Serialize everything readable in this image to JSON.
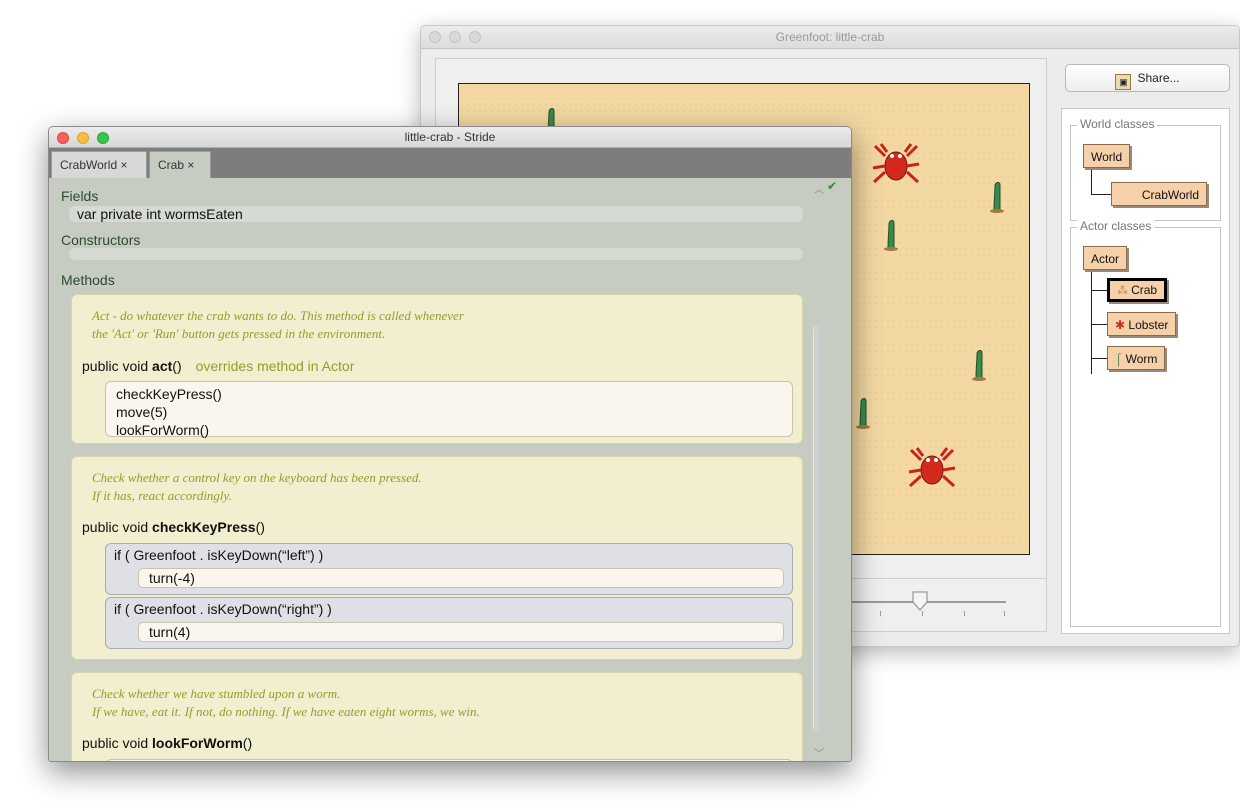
{
  "greenfoot": {
    "title": "Greenfoot: little-crab",
    "share_label": "Share...",
    "world_group_label": "World classes",
    "actor_group_label": "Actor classes",
    "classes": {
      "world": "World",
      "crabworld": "CrabWorld",
      "actor": "Actor",
      "crab": "Crab",
      "lobster": "Lobster",
      "worm": "Worm"
    },
    "colors": {
      "sand": "#f4d8a3",
      "class_box": "#f6d0a8"
    }
  },
  "stride": {
    "title": "little-crab - Stride",
    "tabs": [
      {
        "label": "CrabWorld ×"
      },
      {
        "label": "Crab ×"
      }
    ],
    "fields_label": "Fields",
    "field_decl": "var private int wormsEaten",
    "constructors_label": "Constructors",
    "methods_label": "Methods",
    "methods": [
      {
        "doc": [
          "Act - do whatever the crab wants to do. This method is called whenever",
          "the 'Act' or 'Run' button gets pressed in the environment."
        ],
        "sig_prefix": "public void",
        "name": "act",
        "parens": "()",
        "override": "overrides method in Actor",
        "body": [
          "checkKeyPress()",
          "move(5)",
          "lookForWorm()"
        ]
      },
      {
        "doc": [
          "Check whether a control key on the keyboard has been pressed.",
          "If it has, react accordingly."
        ],
        "sig_prefix": "public void",
        "name": "checkKeyPress",
        "parens": "()",
        "ifs": [
          {
            "cond": "if ( Greenfoot . isKeyDown(“left”) )",
            "stmt": "turn(-4)"
          },
          {
            "cond": "if ( Greenfoot . isKeyDown(“right”) )",
            "stmt": "turn(4)"
          }
        ]
      },
      {
        "doc": [
          "Check whether we have stumbled upon a worm.",
          "If we have, eat it. If not, do nothing. If we have eaten eight worms, we win."
        ],
        "sig_prefix": "public void",
        "name": "lookForWorm",
        "parens": "()"
      }
    ],
    "colors": {
      "editor_bg": "#c6ccc2",
      "method_bg": "#f2eed0",
      "doc_text": "#9a9a2a"
    }
  }
}
